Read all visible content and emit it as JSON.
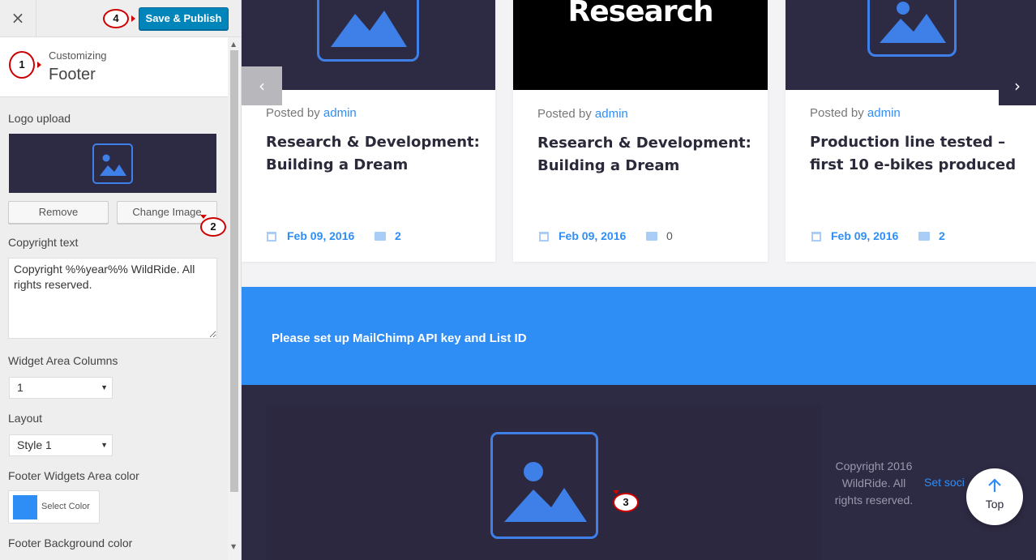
{
  "toolbar": {
    "close_icon": "×",
    "save_label": "Save & Publish"
  },
  "markers": [
    "1",
    "2",
    "3",
    "4"
  ],
  "section": {
    "context": "Customizing",
    "title": "Footer"
  },
  "controls": {
    "logo_upload_label": "Logo upload",
    "remove_label": "Remove",
    "change_image_label": "Change Image",
    "copyright_label": "Copyright text",
    "copyright_value": "Copyright %%year%% WildRide. All rights reserved.",
    "widget_columns_label": "Widget Area Columns",
    "widget_columns_value": "1",
    "layout_label": "Layout",
    "layout_value": "Style 1",
    "widgets_color_label": "Footer Widgets Area color",
    "select_color_label": "Select Color",
    "widgets_color": "#2e8ef5",
    "bg_color_label": "Footer Background color"
  },
  "cards": [
    {
      "image": "image-placeholder-icon",
      "posted_prefix": "Posted by",
      "author": "admin",
      "title": "Research & Development: Building a Dream",
      "date": "Feb 09, 2016",
      "comments": "2"
    },
    {
      "image_text": "Research",
      "posted_prefix": "Posted by",
      "author": "admin",
      "title": "Research & Development: Building a Dream",
      "date": "Feb 09, 2016",
      "comments": "0"
    },
    {
      "image": "image-placeholder-icon",
      "posted_prefix": "Posted by",
      "author": "admin",
      "title": "Production line tested – first 10 e-bikes produced",
      "date": "Feb 09, 2016",
      "comments": "2"
    }
  ],
  "slider": {
    "prev_icon": "‹",
    "next_icon": "›"
  },
  "mailchimp": {
    "message": "Please set up MailChimp API key and List ID"
  },
  "footer": {
    "copyright": "Copyright 2016 WildRide. All rights reserved.",
    "social": "Set soci"
  },
  "top_button": {
    "label": "Top"
  },
  "colors": {
    "accent": "#2e8ef5",
    "dark": "#2d2a43",
    "wp_primary": "#0085ba",
    "marker": "#cc0000"
  }
}
